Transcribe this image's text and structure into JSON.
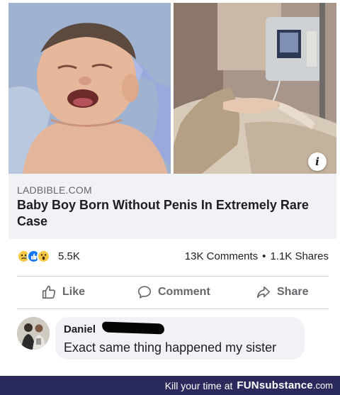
{
  "link_preview": {
    "domain": "LADBIBLE.COM",
    "headline": "Baby Boy Born Without Penis In Extremely Rare Case",
    "info_icon": "info-icon",
    "info_glyph": "i"
  },
  "stats": {
    "reaction_icons": [
      "sad-reaction-icon",
      "like-reaction-icon",
      "wow-reaction-icon"
    ],
    "reaction_count": "5.5K",
    "comments": "13K Comments",
    "separator": "•",
    "shares": "1.1K Shares"
  },
  "actions": {
    "like": "Like",
    "comment": "Comment",
    "share": "Share"
  },
  "comment": {
    "author": "Daniel",
    "text": "Exact same thing happened my sister"
  },
  "footer": {
    "text": "Kill your time at",
    "brand": "FUNsubstance",
    "domain": ".com"
  },
  "colors": {
    "footer_bg": "#2a2a5c",
    "like_blue": "#1877f2",
    "reaction_yellow": "#f7c844",
    "secondary_text": "#65676b"
  }
}
